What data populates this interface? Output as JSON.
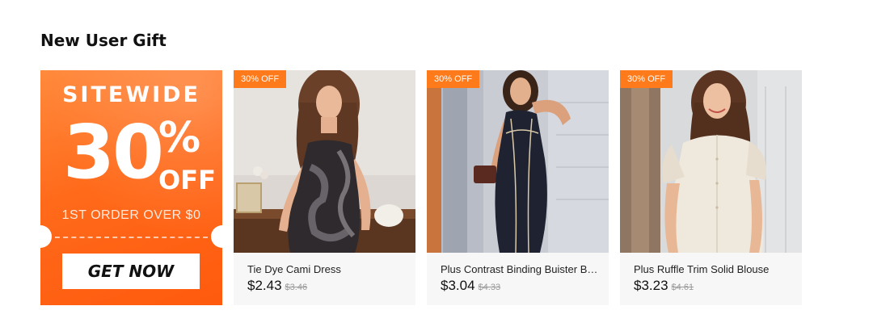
{
  "section": {
    "title": "New User Gift"
  },
  "coupon": {
    "headline": "SITEWIDE",
    "discount_number": "30",
    "percent_sign": "%",
    "off_label": "OFF",
    "condition": "1ST ORDER OVER $0",
    "cta_label": "GET NOW"
  },
  "products": [
    {
      "badge": "30% OFF",
      "name": "Tie Dye Cami Dress",
      "price": "$2.43",
      "original_price": "$3.46"
    },
    {
      "badge": "30% OFF",
      "name": "Plus Contrast Binding Buister Bo...",
      "price": "$3.04",
      "original_price": "$4.33"
    },
    {
      "badge": "30% OFF",
      "name": "Plus Ruffle Trim Solid Blouse",
      "price": "$3.23",
      "original_price": "$4.61"
    }
  ],
  "colors": {
    "accent": "#ff6a1a",
    "badge": "#ff7a1a"
  }
}
